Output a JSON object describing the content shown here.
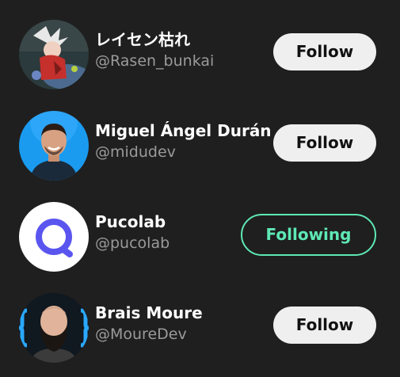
{
  "colors": {
    "background": "#1f1f1f",
    "follow_button_bg": "#efefef",
    "following_accent": "#5ee8b5",
    "handle_text": "#9a9a9a"
  },
  "users": [
    {
      "name": "レイセン枯れ",
      "handle": "@Rasen_bunkai",
      "button_label": "Follow",
      "following": false,
      "avatar_icon": "anime-character-avatar"
    },
    {
      "name": "Miguel Ángel Durán",
      "handle": "@midudev",
      "button_label": "Follow",
      "following": false,
      "avatar_icon": "man-blue-background-avatar"
    },
    {
      "name": "Pucolab",
      "handle": "@pucolab",
      "button_label": "Following",
      "following": true,
      "avatar_icon": "purple-ring-logo-avatar"
    },
    {
      "name": "Brais Moure",
      "handle": "@MoureDev",
      "button_label": "Follow",
      "following": false,
      "avatar_icon": "bearded-man-braces-avatar"
    }
  ]
}
